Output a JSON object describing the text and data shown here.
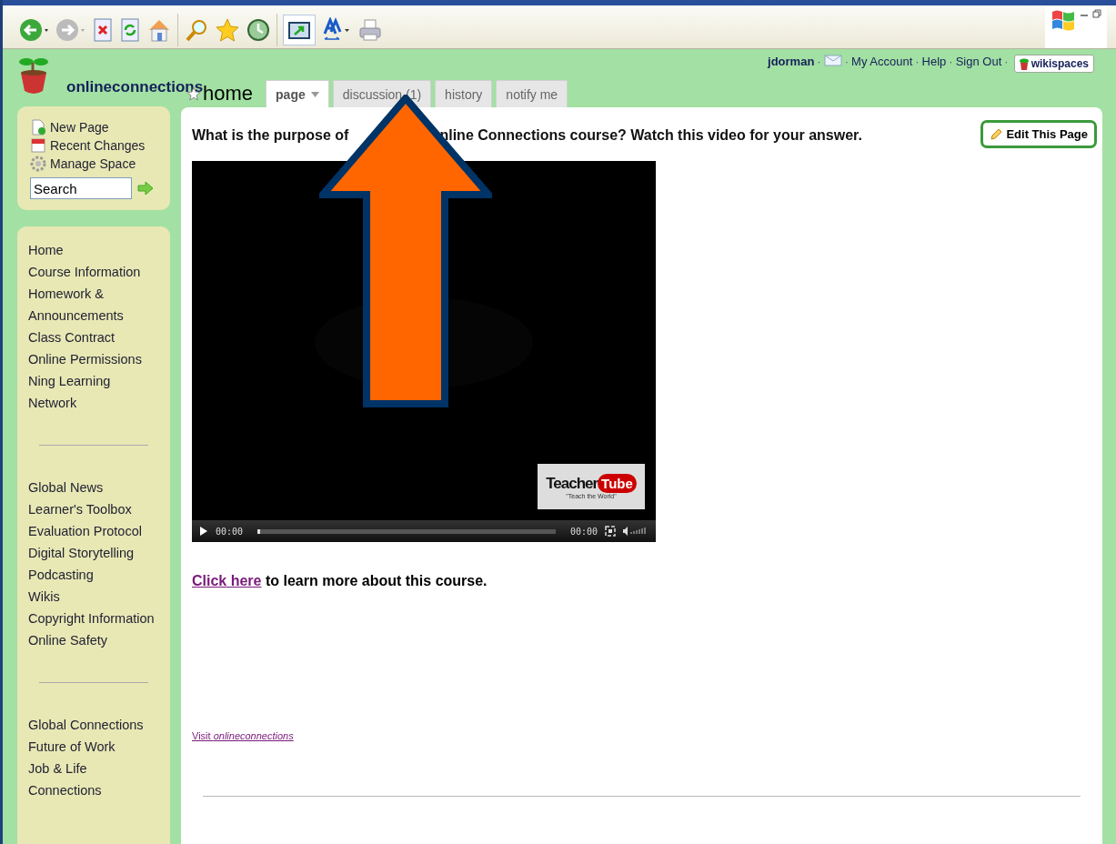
{
  "site": {
    "name": "onlineconnections"
  },
  "user_bar": {
    "user": "jdorman",
    "links": [
      "My Account",
      "Help",
      "Sign Out"
    ],
    "separator": "·",
    "brand": "wikispaces"
  },
  "page": {
    "title": "home"
  },
  "tabs": [
    {
      "label": "page",
      "selected": true,
      "dropdown": true
    },
    {
      "label": "discussion (1)",
      "selected": false,
      "dropdown": false
    },
    {
      "label": "history",
      "selected": false,
      "dropdown": false
    },
    {
      "label": "notify me",
      "selected": false,
      "dropdown": false
    }
  ],
  "tools": [
    {
      "label": "New Page",
      "kind": "new"
    },
    {
      "label": "Recent Changes",
      "kind": "calendar"
    },
    {
      "label": "Manage Space",
      "kind": "gear"
    }
  ],
  "search": {
    "value": "Search"
  },
  "nav_groups": [
    [
      "Home",
      "Course Information",
      "Homework & Announcements",
      "Class Contract",
      "Online Permissions",
      "Ning Learning Network"
    ],
    [
      "Global News",
      "Learner's Toolbox",
      "Evaluation Protocol",
      "Digital Storytelling",
      "Podcasting",
      "Wikis",
      "Copyright Information",
      "Online Safety"
    ],
    [
      "Global Connections",
      "Future of Work",
      "Job & Life Connections"
    ]
  ],
  "content": {
    "heading_parts": [
      "What is the purpose of",
      "nline Connections course? Watch this video for your answer."
    ],
    "edit_button": "Edit This Page",
    "video": {
      "kind": "picture",
      "elapsed": "00:00",
      "duration": "00:00",
      "logo": "Teacher",
      "logo_tail": "Tube",
      "tagline": "\"Teach the World\""
    },
    "link": "Click here",
    "link_rest": "to learn more about this course.",
    "visit": "Visit *onlineconnections*"
  }
}
